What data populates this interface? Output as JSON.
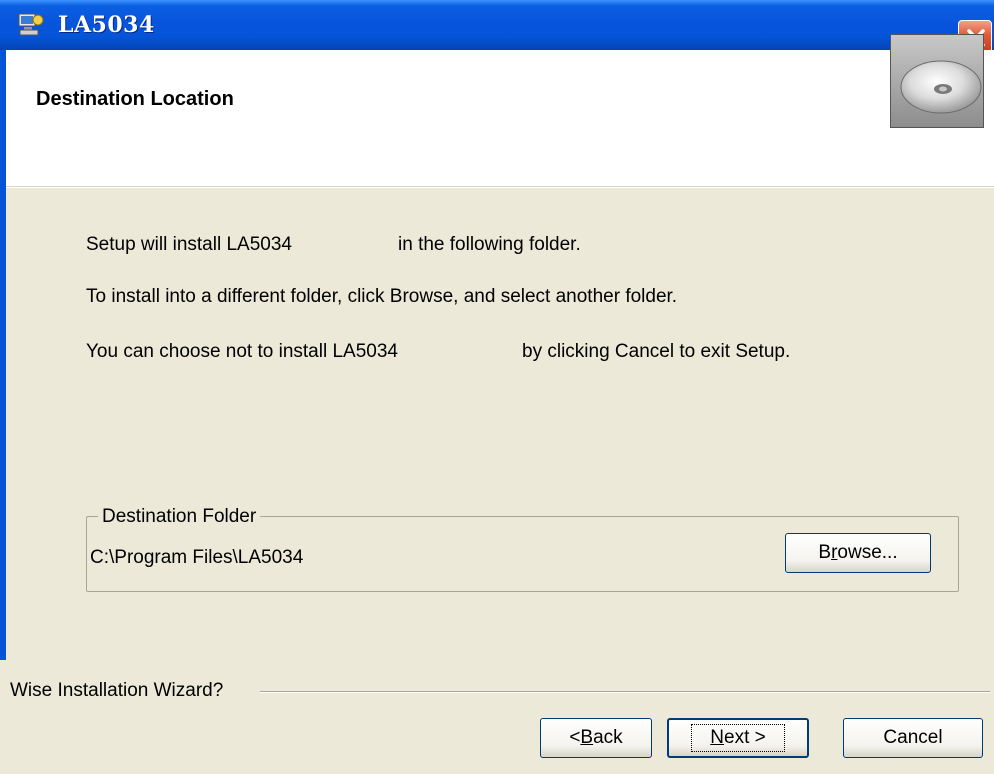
{
  "window": {
    "title": "LA5034",
    "app_icon": "installer-icon",
    "close_icon": "close-icon"
  },
  "header": {
    "title": "Destination Location",
    "image": "cd-disc-icon"
  },
  "body": {
    "line1_a": "Setup will install LA5034",
    "line1_b": "in the following folder.",
    "line2": "To install into a different folder, click Browse, and select another folder.",
    "line3_a": "You can choose not to install LA5034",
    "line3_b": "by clicking Cancel to exit Setup."
  },
  "destination": {
    "group_label": "Destination Folder",
    "path": "C:\\Program Files\\LA5034",
    "browse_label_pre": "B",
    "browse_label_ul": "r",
    "browse_label_post": "owse..."
  },
  "footer": {
    "wizard_label": "Wise Installation Wizard?",
    "back_pre": "< ",
    "back_ul": "B",
    "back_post": "ack",
    "next_ul": "N",
    "next_post": "ext >",
    "cancel_label": "Cancel"
  },
  "colors": {
    "titlebar": "#0553d6",
    "dialog_bg": "#ece9d8",
    "close_button": "#e05a3a"
  }
}
